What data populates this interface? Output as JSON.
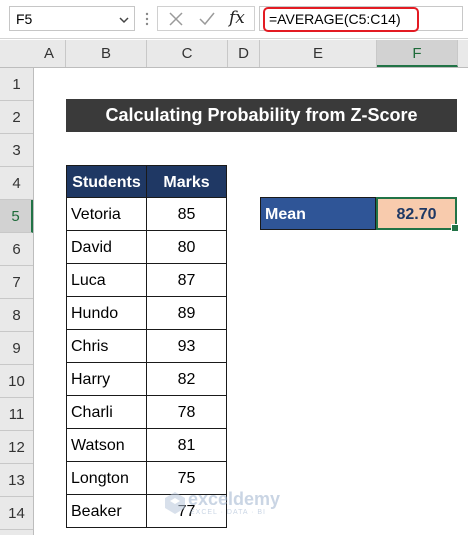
{
  "formula_bar": {
    "name_box": "F5",
    "fx_symbol": "fx",
    "formula": "=AVERAGE(C5:C14)"
  },
  "columns": [
    "A",
    "B",
    "C",
    "D",
    "E",
    "F"
  ],
  "rows": [
    "1",
    "2",
    "3",
    "4",
    "5",
    "6",
    "7",
    "8",
    "9",
    "10",
    "11",
    "12",
    "13",
    "14"
  ],
  "selected": {
    "column": "F",
    "row": "5"
  },
  "sheet": {
    "title": "Calculating Probability from Z-Score",
    "table": {
      "headers": [
        "Students",
        "Marks"
      ],
      "rows": [
        [
          "Vetoria",
          "85"
        ],
        [
          "David",
          "80"
        ],
        [
          "Luca",
          "87"
        ],
        [
          "Hundo",
          "89"
        ],
        [
          "Chris",
          "93"
        ],
        [
          "Harry",
          "82"
        ],
        [
          "Charli",
          "78"
        ],
        [
          "Watson",
          "81"
        ],
        [
          "Longton",
          "75"
        ],
        [
          "Beaker",
          "77"
        ]
      ]
    },
    "mean": {
      "label": "Mean",
      "value": "82.70"
    }
  },
  "watermark": {
    "brand": "exceldemy",
    "tagline": "EXCEL · DATA · BI"
  },
  "colors": {
    "title_bg": "#3a3a3a",
    "table_header_bg": "#1f3864",
    "mean_label_bg": "#2f5597",
    "mean_value_bg": "#f8cbad",
    "selection": "#217346",
    "formula_highlight": "#e31b23"
  }
}
